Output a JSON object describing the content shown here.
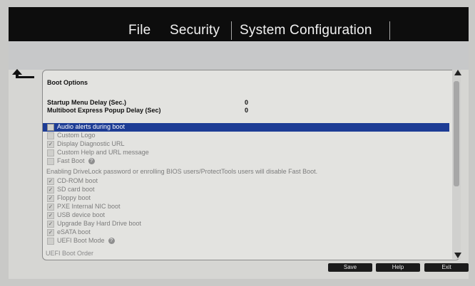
{
  "menu": {
    "file": "File",
    "security": "Security",
    "system_configuration": "System Configuration"
  },
  "boot_options": {
    "title": "Boot Options",
    "startup_menu_delay_label": "Startup Menu Delay (Sec.)",
    "startup_menu_delay_value": "0",
    "multiboot_delay_label": "Multiboot Express Popup Delay (Sec)",
    "multiboot_delay_value": "0",
    "items": [
      {
        "label": "Audio alerts during boot",
        "checked": false,
        "highlight": true
      },
      {
        "label": "Custom Logo",
        "checked": false
      },
      {
        "label": "Display Diagnostic URL",
        "checked": true
      },
      {
        "label": "Custom Help and URL message",
        "checked": false
      },
      {
        "label": "Fast Boot",
        "checked": false,
        "help": true
      }
    ],
    "drivelock_note": "Enabling DriveLock password or enrolling BIOS users/ProtectTools users will disable Fast Boot.",
    "devices": [
      {
        "label": "CD-ROM boot",
        "checked": true
      },
      {
        "label": "SD card boot",
        "checked": true
      },
      {
        "label": "Floppy boot",
        "checked": true
      },
      {
        "label": "PXE Internal NIC boot",
        "checked": true
      },
      {
        "label": "USB device boot",
        "checked": true
      },
      {
        "label": "Upgrade Bay Hard Drive boot",
        "checked": true
      },
      {
        "label": "eSATA boot",
        "checked": true
      },
      {
        "label": "UEFI Boot Mode",
        "checked": false,
        "help": true
      }
    ],
    "uefi_boot_order": "UEFI Boot Order"
  },
  "buttons": {
    "save": "Save",
    "help": "Help",
    "exit": "Exit"
  },
  "colors": {
    "highlight": "#1d3c95",
    "topbar": "#0d0d0d"
  }
}
